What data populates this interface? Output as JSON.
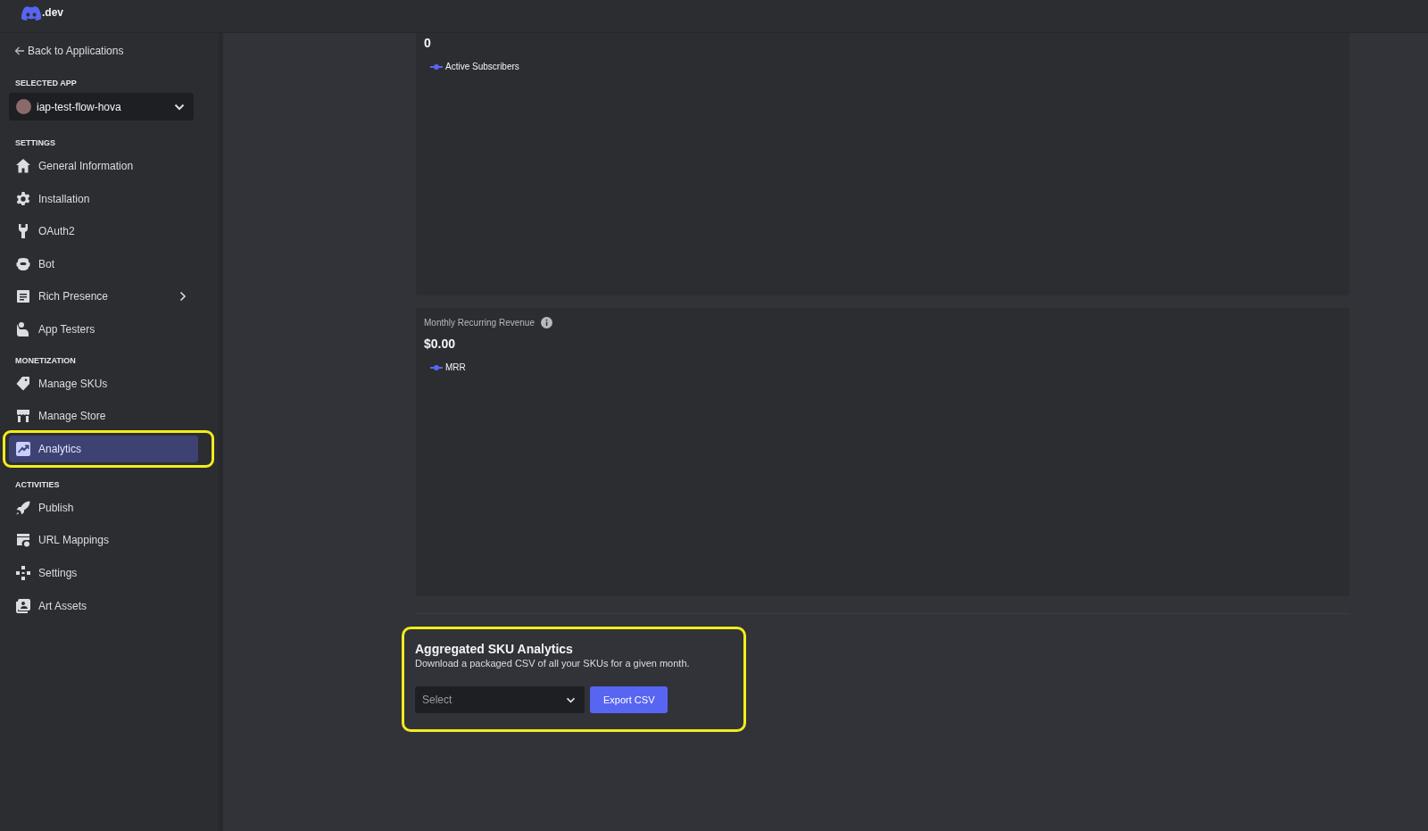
{
  "topbar": {
    "logo_text": ".dev"
  },
  "sidebar": {
    "back_link": "Back to Applications",
    "selected_app_label": "SELECTED APP",
    "selected_app": "iap-test-flow-hova",
    "sections": [
      {
        "title": "SETTINGS",
        "items": [
          {
            "label": "General Information",
            "selected": false,
            "expandable": false,
            "highlighted": false
          },
          {
            "label": "Installation",
            "selected": false,
            "expandable": false,
            "highlighted": false
          },
          {
            "label": "OAuth2",
            "selected": false,
            "expandable": false,
            "highlighted": false
          },
          {
            "label": "Bot",
            "selected": false,
            "expandable": false,
            "highlighted": false
          },
          {
            "label": "Rich Presence",
            "selected": false,
            "expandable": true,
            "highlighted": false
          },
          {
            "label": "App Testers",
            "selected": false,
            "expandable": false,
            "highlighted": false
          }
        ]
      },
      {
        "title": "MONETIZATION",
        "items": [
          {
            "label": "Manage SKUs",
            "selected": false,
            "expandable": false,
            "highlighted": false
          },
          {
            "label": "Manage Store",
            "selected": false,
            "expandable": false,
            "highlighted": false
          },
          {
            "label": "Analytics",
            "selected": true,
            "expandable": false,
            "highlighted": true
          }
        ]
      },
      {
        "title": "ACTIVITIES",
        "items": [
          {
            "label": "Publish",
            "selected": false,
            "expandable": false,
            "highlighted": false
          },
          {
            "label": "URL Mappings",
            "selected": false,
            "expandable": false,
            "highlighted": false
          },
          {
            "label": "Settings",
            "selected": false,
            "expandable": false,
            "highlighted": false
          },
          {
            "label": "Art Assets",
            "selected": false,
            "expandable": false,
            "highlighted": false
          }
        ]
      }
    ]
  },
  "cards": [
    {
      "value": "0",
      "legend": "Active Subscribers"
    },
    {
      "title": "Monthly Recurring Revenue",
      "value": "$0.00",
      "legend": "MRR"
    }
  ],
  "sku_export": {
    "title": "Aggregated SKU Analytics",
    "description": "Download a packaged CSV of all your SKUs for a given month.",
    "select": {
      "placeholder": "Select"
    },
    "button": "Export CSV",
    "highlighted": true
  }
}
